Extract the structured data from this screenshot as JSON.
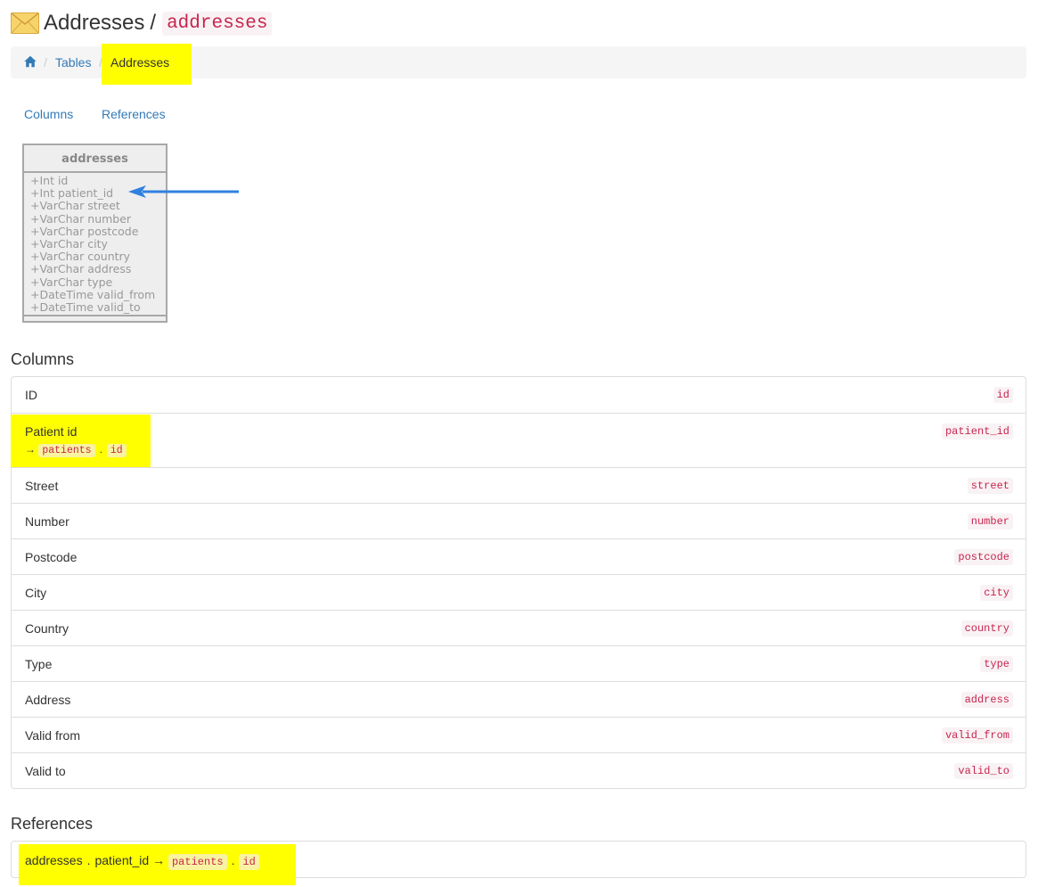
{
  "header": {
    "title": "Addresses",
    "separator": "/",
    "table_code": "addresses",
    "icon": "envelope-icon"
  },
  "breadcrumb": {
    "home_icon": "home-icon",
    "items": [
      "Tables",
      "Addresses"
    ],
    "separator": "/"
  },
  "tabs": [
    "Columns",
    "References"
  ],
  "diagram": {
    "table_name": "addresses",
    "fields": [
      "+Int id",
      "+Int patient_id",
      "+VarChar street",
      "+VarChar number",
      "+VarChar postcode",
      "+VarChar city",
      "+VarChar country",
      "+VarChar address",
      "+VarChar type",
      "+DateTime valid_from",
      "+DateTime valid_to"
    ],
    "annotation_arrow_color": "#2f80e0"
  },
  "columns": {
    "heading": "Columns",
    "rows": [
      {
        "label": "ID",
        "code": "id"
      },
      {
        "label": "Patient id",
        "code": "patient_id",
        "ref_arrow": "→",
        "ref_table": "patients",
        "ref_sep": ".",
        "ref_column": "id"
      },
      {
        "label": "Street",
        "code": "street"
      },
      {
        "label": "Number",
        "code": "number"
      },
      {
        "label": "Postcode",
        "code": "postcode"
      },
      {
        "label": "City",
        "code": "city"
      },
      {
        "label": "Country",
        "code": "country"
      },
      {
        "label": "Type",
        "code": "type"
      },
      {
        "label": "Address",
        "code": "address"
      },
      {
        "label": "Valid from",
        "code": "valid_from"
      },
      {
        "label": "Valid to",
        "code": "valid_to"
      }
    ]
  },
  "references": {
    "heading": "References",
    "items": [
      {
        "table": "addresses",
        "sep": ".",
        "column": "patient_id",
        "arrow": "→",
        "ref_table": "patients",
        "ref_sep": ".",
        "ref_column": "id"
      }
    ]
  },
  "colors": {
    "highlight": "#ffff00",
    "link": "#337ab7",
    "code_text": "#c7254e",
    "code_bg": "#f9f2f4"
  }
}
